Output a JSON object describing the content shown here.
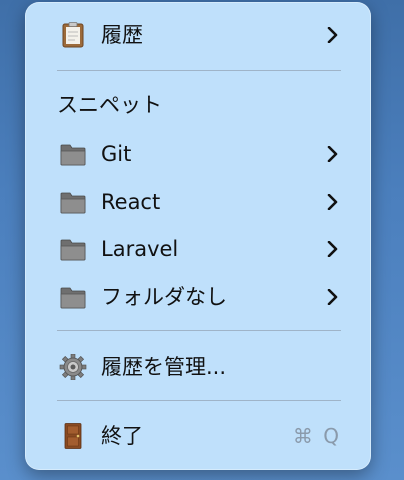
{
  "menu": {
    "history": {
      "label": "履歴",
      "icon": "clipboard-icon"
    },
    "snippets_header": "スニペット",
    "folders": [
      {
        "label": "Git",
        "icon": "folder-icon"
      },
      {
        "label": "React",
        "icon": "folder-icon"
      },
      {
        "label": "Laravel",
        "icon": "folder-icon"
      },
      {
        "label": "フォルダなし",
        "icon": "folder-icon"
      }
    ],
    "manage": {
      "label": "履歴を管理...",
      "icon": "gear-icon"
    },
    "quit": {
      "label": "終了",
      "icon": "door-icon",
      "shortcut": "⌘ Q"
    }
  },
  "colors": {
    "menu_background": "#bfe0fb",
    "separator": "#9fb4c8",
    "shortcut_text": "#8a9aab"
  }
}
